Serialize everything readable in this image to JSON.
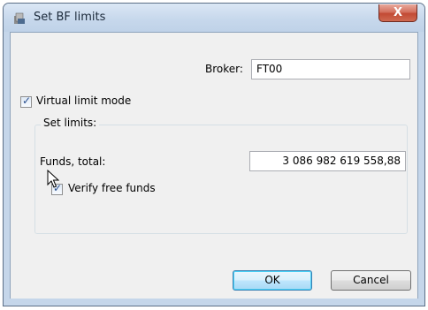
{
  "window": {
    "title": "Set BF limits",
    "close_glyph": "X",
    "icon": "app-icon"
  },
  "broker": {
    "label": "Broker:",
    "value": "FT00"
  },
  "virtual_limit": {
    "label": "Virtual limit mode",
    "checked": true
  },
  "set_limits": {
    "group_label": "Set limits:",
    "funds_label": "Funds, total:",
    "funds_value": "3 086 982 619 558,88",
    "verify_label": "Verify free funds",
    "verify_checked": true
  },
  "buttons": {
    "ok": "OK",
    "cancel": "Cancel"
  },
  "checkmark_glyph": "✓"
}
